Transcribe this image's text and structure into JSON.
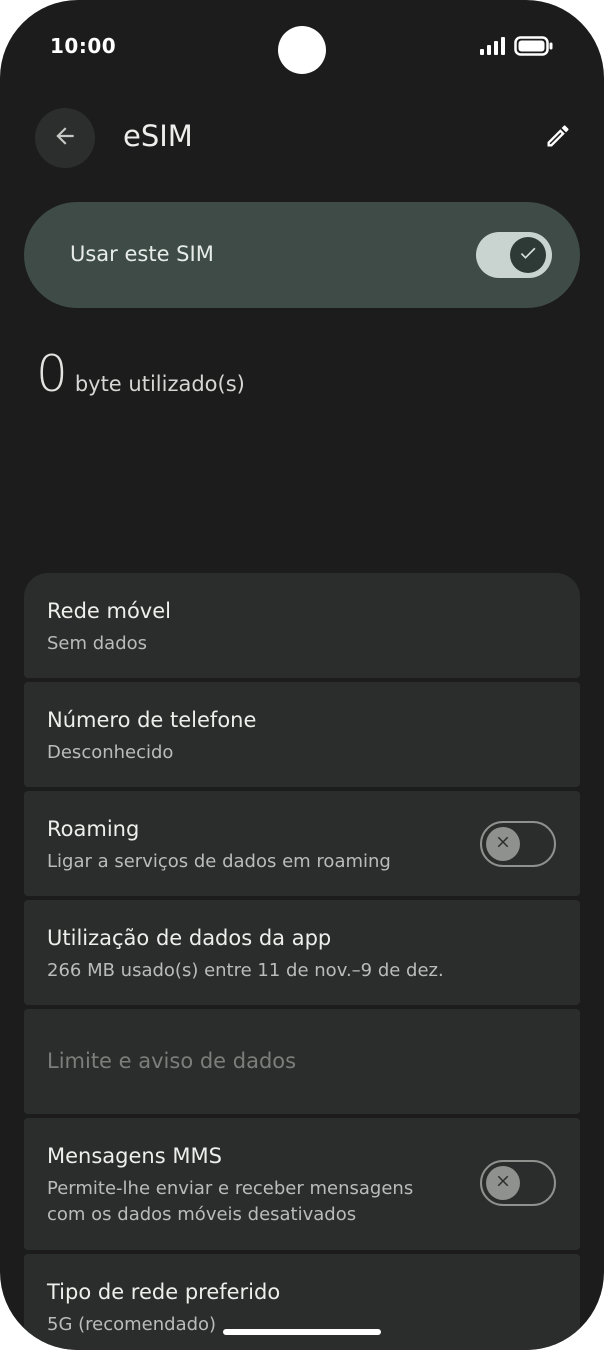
{
  "status_bar": {
    "time": "10:00",
    "signal_icon": "signal-icon",
    "battery_icon": "battery-icon"
  },
  "header": {
    "back_icon": "arrow-back-icon",
    "title": "eSIM",
    "edit_icon": "pencil-icon"
  },
  "use_sim": {
    "label": "Usar este SIM",
    "enabled": true
  },
  "usage": {
    "amount": "0",
    "unit": "byte utilizado(s)"
  },
  "settings": [
    {
      "title": "Rede móvel",
      "subtitle": "Sem dados"
    },
    {
      "title": "Número de telefone",
      "subtitle": "Desconhecido"
    },
    {
      "title": "Roaming",
      "subtitle": "Ligar a serviços de dados em roaming",
      "toggle": false
    },
    {
      "title": "Utilização de dados da app",
      "subtitle": "266 MB usado(s) entre 11 de nov.–9 de dez."
    },
    {
      "title": "Limite e aviso de dados",
      "disabled": true
    },
    {
      "title": "Mensagens MMS",
      "subtitle_line1": "Permite-lhe enviar e receber mensagens",
      "subtitle_line2": "com os dados móveis desativados",
      "toggle": false
    },
    {
      "title": "Tipo de rede preferido",
      "subtitle": "5G (recomendado)"
    }
  ],
  "colors": {
    "background": "#1b1c1b",
    "card": "#2b2d2c",
    "use_sim_card": "#3e4b47",
    "toggle_on": "#c9d3cf"
  }
}
